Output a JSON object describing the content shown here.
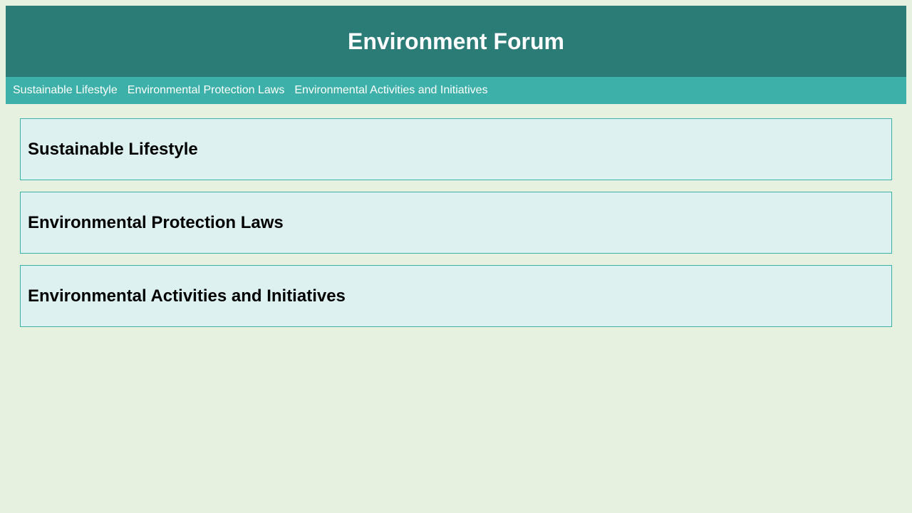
{
  "header": {
    "title": "Environment Forum"
  },
  "nav": {
    "items": [
      {
        "label": "Sustainable Lifestyle"
      },
      {
        "label": "Environmental Protection Laws"
      },
      {
        "label": "Environmental Activities and Initiatives"
      }
    ]
  },
  "sections": [
    {
      "title": "Sustainable Lifestyle"
    },
    {
      "title": "Environmental Protection Laws"
    },
    {
      "title": "Environmental Activities and Initiatives"
    }
  ],
  "colors": {
    "header_bg": "#2b7b77",
    "nav_bg": "#3cb0a9",
    "page_bg": "#e6f1e0",
    "section_bg": "#ddf1f0",
    "section_border": "#3cb0a9"
  }
}
